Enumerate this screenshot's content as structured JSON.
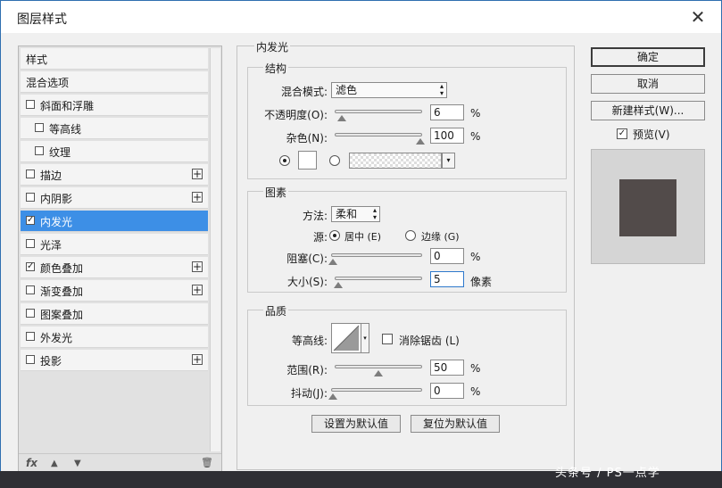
{
  "dialog": {
    "title": "图层样式",
    "close_glyph": "✕"
  },
  "left_panel": {
    "items": [
      {
        "label": "样式",
        "checkbox": false,
        "checked": false,
        "plus": false,
        "selected": false
      },
      {
        "label": "混合选项",
        "checkbox": false,
        "checked": false,
        "plus": false,
        "selected": false
      },
      {
        "label": "斜面和浮雕",
        "checkbox": true,
        "checked": false,
        "plus": false,
        "selected": false
      },
      {
        "label": "等高线",
        "checkbox": true,
        "checked": false,
        "plus": false,
        "selected": false
      },
      {
        "label": "纹理",
        "checkbox": true,
        "checked": false,
        "plus": false,
        "selected": false
      },
      {
        "label": "描边",
        "checkbox": true,
        "checked": false,
        "plus": true,
        "selected": false
      },
      {
        "label": "内阴影",
        "checkbox": true,
        "checked": false,
        "plus": true,
        "selected": false
      },
      {
        "label": "内发光",
        "checkbox": true,
        "checked": true,
        "plus": false,
        "selected": true
      },
      {
        "label": "光泽",
        "checkbox": true,
        "checked": false,
        "plus": false,
        "selected": false
      },
      {
        "label": "颜色叠加",
        "checkbox": true,
        "checked": true,
        "plus": true,
        "selected": false
      },
      {
        "label": "渐变叠加",
        "checkbox": true,
        "checked": false,
        "plus": true,
        "selected": false
      },
      {
        "label": "图案叠加",
        "checkbox": true,
        "checked": false,
        "plus": false,
        "selected": false
      },
      {
        "label": "外发光",
        "checkbox": true,
        "checked": false,
        "plus": false,
        "selected": false
      },
      {
        "label": "投影",
        "checkbox": true,
        "checked": false,
        "plus": true,
        "selected": false
      }
    ],
    "footer": {
      "fx": "fx",
      "up": "▲",
      "down": "▼",
      "trash": "🗑"
    }
  },
  "center": {
    "section_title": "内发光",
    "structure": {
      "title": "结构",
      "blend_mode_label": "混合模式:",
      "blend_mode_value": "滤色",
      "opacity_label": "不透明度(O):",
      "opacity_value": "6",
      "opacity_level": 6,
      "noise_label": "杂色(N):",
      "noise_value": "100",
      "noise_level": 100,
      "unit": "%"
    },
    "elements": {
      "title": "图素",
      "method_label": "方法:",
      "method_value": "柔和",
      "source_label": "源:",
      "source_center": "居中 (E)",
      "source_edge": "边缘 (G)",
      "choke_label": "阻塞(C):",
      "choke_value": "0",
      "choke_level": 0,
      "size_label": "大小(S):",
      "size_value": "5",
      "size_level": 2,
      "size_unit": "像素",
      "unit": "%"
    },
    "quality": {
      "title": "品质",
      "contour_label": "等高线:",
      "anti_alias_label": "消除锯齿 (L)",
      "range_label": "范围(R):",
      "range_value": "50",
      "range_level": 50,
      "jitter_label": "抖动(J):",
      "jitter_value": "0",
      "jitter_level": 0,
      "unit": "%"
    },
    "buttons": {
      "set_default": "设置为默认值",
      "reset_default": "复位为默认值"
    }
  },
  "right": {
    "ok": "确定",
    "cancel": "取消",
    "new_style": "新建样式(W)...",
    "preview_label": "预览(V)",
    "preview_checked": true,
    "swatch_color": "#524b4a"
  },
  "watermark": "头条号 / PS一点学"
}
